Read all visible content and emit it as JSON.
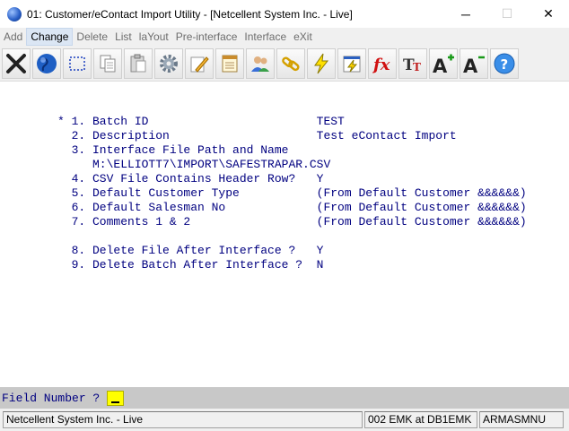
{
  "window": {
    "title": "01: Customer/eContact Import Utility - [Netcellent System Inc. - Live]",
    "minimize": "─",
    "maximize": "☐",
    "close": "✕"
  },
  "menu": {
    "items": [
      {
        "label": "Add"
      },
      {
        "label": "Change"
      },
      {
        "label": "Delete"
      },
      {
        "label": "List"
      },
      {
        "label": "laYout"
      },
      {
        "label": "Pre-interface"
      },
      {
        "label": "Interface"
      },
      {
        "label": "eXit"
      }
    ]
  },
  "toolbar": {
    "buttons": [
      {
        "icon": "close-x-icon"
      },
      {
        "icon": "globe-icon"
      },
      {
        "icon": "select-rectangle-icon"
      },
      {
        "icon": "copy-icon"
      },
      {
        "icon": "paste-icon"
      },
      {
        "icon": "gear-icon"
      },
      {
        "icon": "edit-pencil-icon"
      },
      {
        "icon": "notepad-icon"
      },
      {
        "icon": "users-icon"
      },
      {
        "icon": "chain-link-icon"
      },
      {
        "icon": "lightning-icon"
      },
      {
        "icon": "document-lightning-icon"
      },
      {
        "icon": "function-fx-icon"
      },
      {
        "icon": "font-size-icon"
      },
      {
        "icon": "increase-font-icon"
      },
      {
        "icon": "decrease-font-icon"
      },
      {
        "icon": "help-icon"
      }
    ]
  },
  "form": {
    "lines": [
      {
        "text": "* 1. Batch ID                        TEST"
      },
      {
        "text": "  2. Description                     Test eContact Import"
      },
      {
        "text": "  3. Interface File Path and Name"
      },
      {
        "text": "     M:\\ELLIOTT7\\IMPORT\\SAFESTRAPAR.CSV"
      },
      {
        "text": "  4. CSV File Contains Header Row?   Y"
      },
      {
        "text": "  5. Default Customer Type           (From Default Customer &&&&&&)"
      },
      {
        "text": "  6. Default Salesman No             (From Default Customer &&&&&&)"
      },
      {
        "text": "  7. Comments 1 & 2                  (From Default Customer &&&&&&)"
      },
      {
        "text": "  8. Delete File After Interface ?   Y"
      },
      {
        "text": "  9. Delete Batch After Interface ?  N"
      }
    ]
  },
  "prompt": {
    "label": "Field Number ?"
  },
  "status": {
    "company": "Netcellent System Inc. - Live",
    "user": "002 EMK at DB1EMK",
    "program": "ARMASMNU"
  },
  "colors": {
    "form_text": "#000080",
    "input_highlight": "#ffff00"
  }
}
